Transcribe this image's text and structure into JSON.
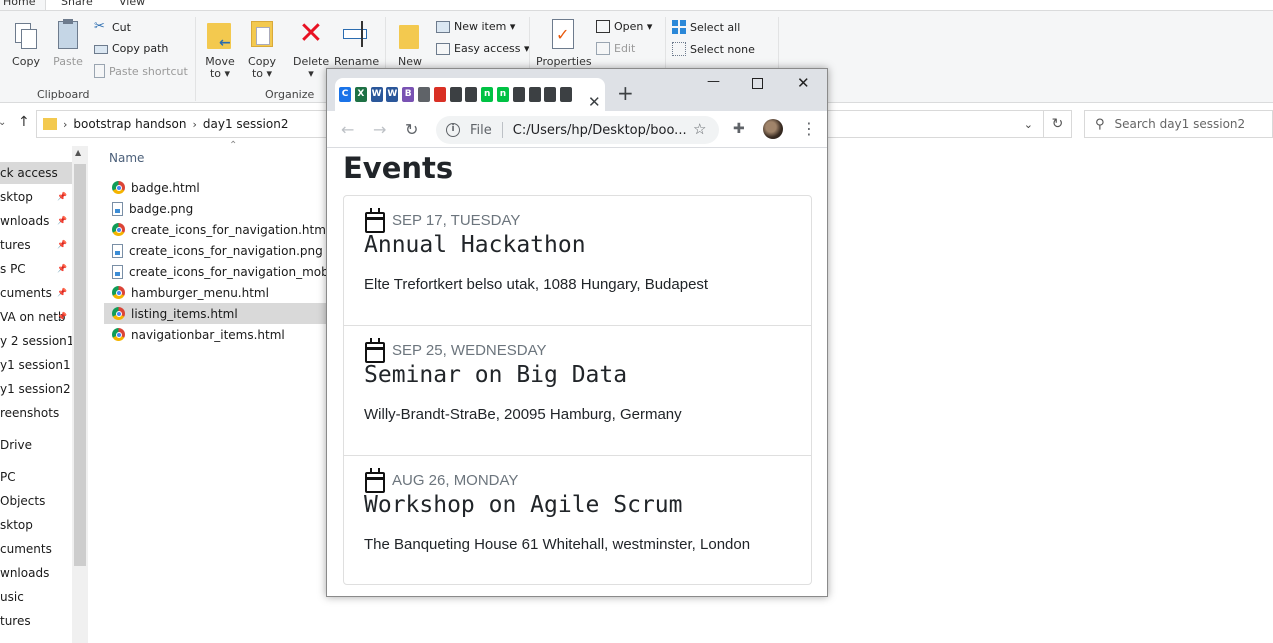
{
  "explorer": {
    "ribbon_tabs": {
      "home": "Home",
      "share": "Share",
      "view": "View"
    },
    "clipboard": {
      "label": "Clipboard",
      "copy": "Copy",
      "paste": "Paste",
      "cut": "Cut",
      "copy_path": "Copy path",
      "paste_shortcut": "Paste shortcut"
    },
    "organize": {
      "label": "Organize",
      "move_to": "Move",
      "move_to_sub": "to ▾",
      "copy_to": "Copy",
      "copy_to_sub": "to ▾",
      "delete": "Delete",
      "delete_sub": "▾",
      "rename": "Rename"
    },
    "new_group": {
      "new": "New",
      "new_item": "New item ▾",
      "easy_access": "Easy access ▾"
    },
    "open_group": {
      "properties": "Properties",
      "open": "Open ▾",
      "edit": "Edit"
    },
    "select_group": {
      "select_all": "Select all",
      "select_none": "Select none"
    },
    "address": {
      "crumbs": [
        "bootstrap handson",
        "day1 session2"
      ]
    },
    "search_placeholder": "Search day1 session2",
    "column_name": "Name",
    "nav_items": [
      "ck access",
      "sktop",
      "wnloads",
      "tures",
      "s PC",
      "cuments",
      "VA on netb",
      "y 2 session1",
      "y1 session1",
      "y1 session2",
      "reenshots",
      "Drive",
      "PC",
      " Objects",
      "sktop",
      "cuments",
      "wnloads",
      "usic",
      "tures"
    ],
    "files": [
      {
        "name": "badge.html",
        "type": "chrome"
      },
      {
        "name": "badge.png",
        "type": "png"
      },
      {
        "name": "create_icons_for_navigation.html",
        "type": "chrome"
      },
      {
        "name": "create_icons_for_navigation.png",
        "type": "png"
      },
      {
        "name": "create_icons_for_navigation_mobile.png",
        "type": "png"
      },
      {
        "name": "hamburger_menu.html",
        "type": "chrome"
      },
      {
        "name": "listing_items.html",
        "type": "chrome"
      },
      {
        "name": "navigationbar_items.html",
        "type": "chrome"
      }
    ]
  },
  "browser": {
    "omnibox_label": "File",
    "url": "C:/Users/hp/Desktop/boo...",
    "favicons": [
      {
        "letter": "C",
        "color": "#1a73e8"
      },
      {
        "letter": "X",
        "color": "#1e7145"
      },
      {
        "letter": "W",
        "color": "#2b579a"
      },
      {
        "letter": "W",
        "color": "#2b579a"
      },
      {
        "letter": "B",
        "color": "#7952b3"
      },
      {
        "letter": "",
        "color": "#5f6368"
      },
      {
        "letter": "",
        "color": "#d93025"
      },
      {
        "letter": "",
        "color": "#3c4043"
      },
      {
        "letter": "",
        "color": "#3c4043"
      },
      {
        "letter": "n",
        "color": "#00c244"
      },
      {
        "letter": "n",
        "color": "#00c244"
      },
      {
        "letter": "",
        "color": "#3c4043"
      },
      {
        "letter": "",
        "color": "#3c4043"
      },
      {
        "letter": "",
        "color": "#3c4043"
      },
      {
        "letter": "",
        "color": "#3c4043"
      }
    ],
    "page": {
      "title": "Events",
      "events": [
        {
          "date": "SEP 17, TUESDAY",
          "title": "Annual Hackathon",
          "address": "Elte Trefortkert belso utak, 1088 Hungary, Budapest"
        },
        {
          "date": "SEP 25, WEDNESDAY",
          "title": "Seminar on Big Data",
          "address": "Willy-Brandt-StraBe, 20095 Hamburg, Germany"
        },
        {
          "date": "AUG 26, MONDAY",
          "title": "Workshop on Agile Scrum",
          "address": "The Banqueting House 61 Whitehall, westminster, London"
        }
      ]
    }
  }
}
